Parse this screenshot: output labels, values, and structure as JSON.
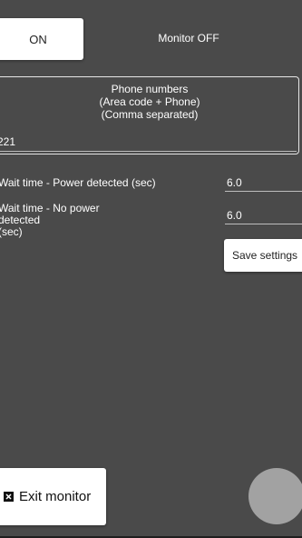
{
  "controls": {
    "on_label": "ON",
    "monitor_status": "Monitor OFF"
  },
  "phone": {
    "label_line1": "Phone numbers",
    "label_line2": "(Area code + Phone)",
    "label_line3": "(Comma separated)",
    "value": "221"
  },
  "settings": {
    "power_detected_label": "Wait time - Power detected (sec)",
    "power_detected_value": "6.0",
    "no_power_label_line1": "Wait time - No power detected",
    "no_power_label_line2": "(sec)",
    "no_power_value": "6.0",
    "save_label": "Save settings"
  },
  "footer": {
    "exit_label": "Exit monitor",
    "exit_icon": "close-box-icon"
  },
  "colors": {
    "background": "#4a4a4a",
    "button": "#ffffff",
    "fab": "#a2a2a2"
  }
}
